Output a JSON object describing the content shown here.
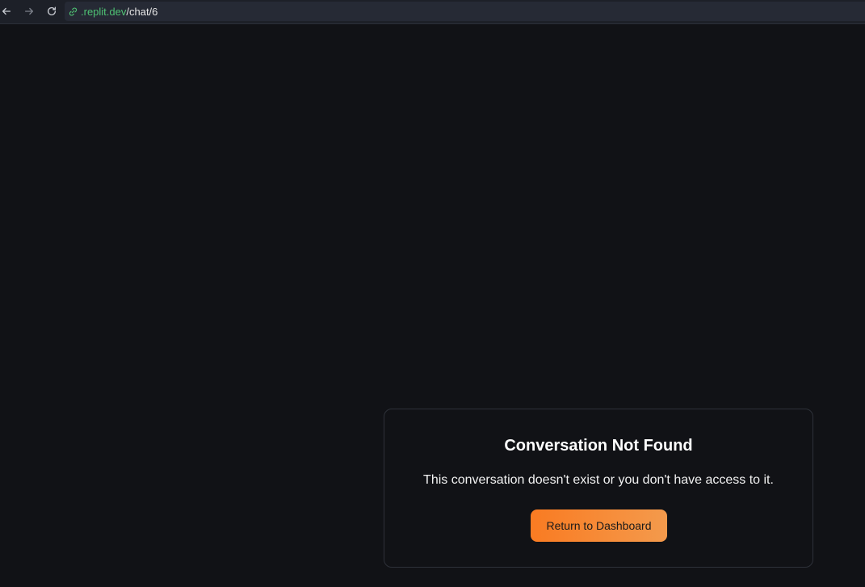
{
  "browser": {
    "url_host": ".replit.dev",
    "url_path": "/chat/6",
    "back_icon": "arrow-left-icon",
    "forward_icon": "arrow-right-icon",
    "reload_icon": "reload-icon",
    "link_icon": "link-icon"
  },
  "error_card": {
    "title": "Conversation Not Found",
    "message": "This conversation doesn't exist or you don't have access to it.",
    "button_label": "Return to Dashboard"
  },
  "colors": {
    "background": "#111216",
    "url_host": "#4fc374",
    "accent": "#f97b22"
  }
}
